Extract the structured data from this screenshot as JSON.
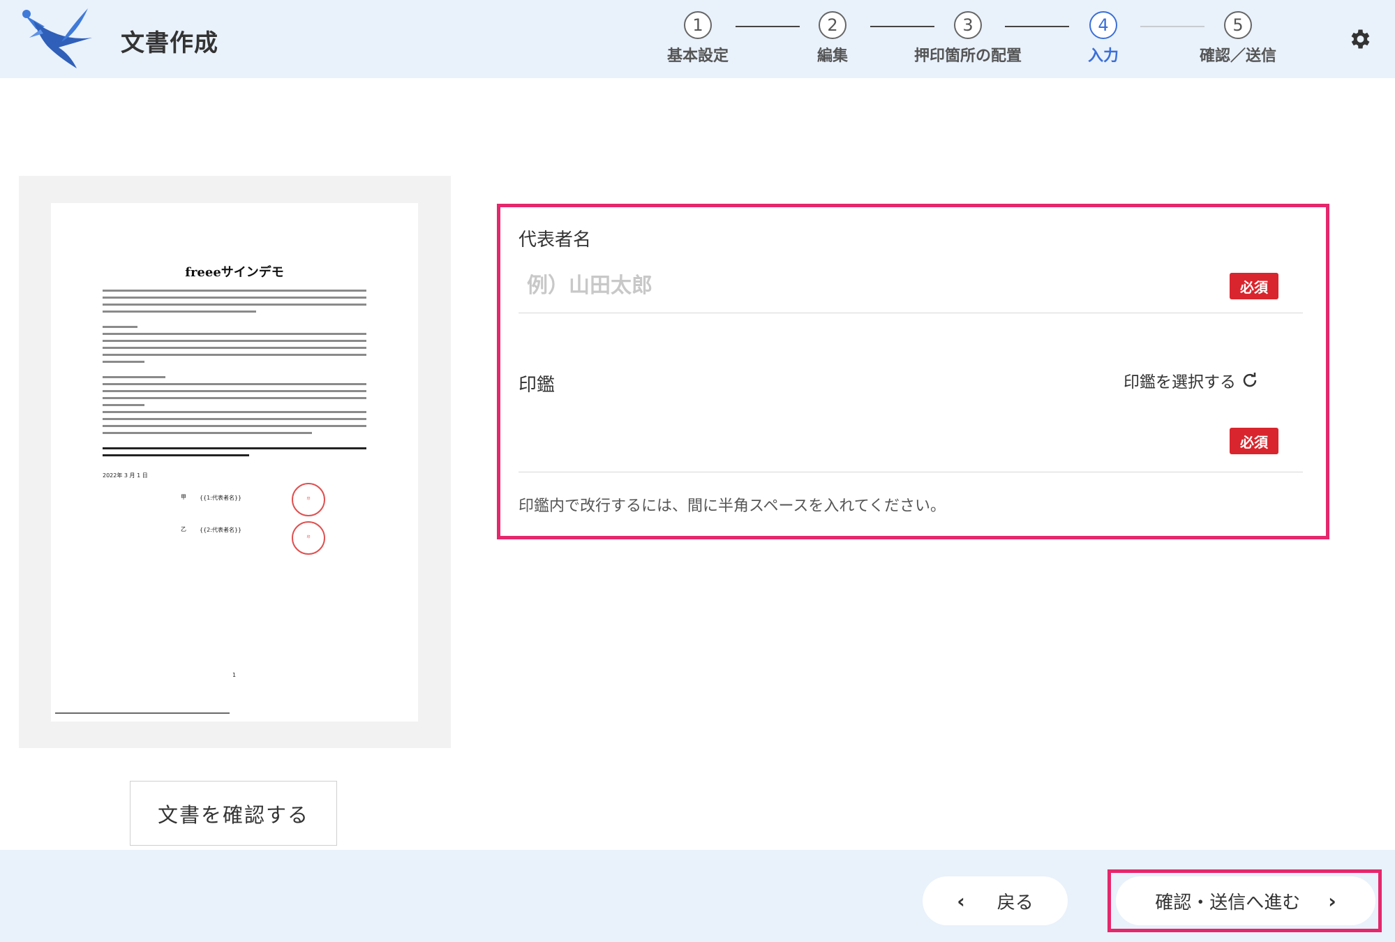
{
  "header": {
    "title": "文書作成",
    "steps": [
      {
        "number": "1",
        "label": "基本設定"
      },
      {
        "number": "2",
        "label": "編集"
      },
      {
        "number": "3",
        "label": "押印箇所の配置"
      },
      {
        "number": "4",
        "label": "入力"
      },
      {
        "number": "5",
        "label": "確認／送信"
      }
    ],
    "active_step": 4
  },
  "preview": {
    "doc_title": "freeeサインデモ",
    "date_text": "2022年 3 月 1 日",
    "party_a": "甲",
    "party_a_name": "{{1:代表者名}}",
    "party_b": "乙",
    "party_b_name": "{{2:代表者名}}",
    "page_number": "1",
    "confirm_button": "文書を確認する"
  },
  "form": {
    "rep_name_label": "代表者名",
    "rep_name_value": "",
    "rep_name_placeholder": "例）山田太郎",
    "required_label": "必須",
    "seal_label": "印鑑",
    "seal_select_label": "印鑑を選択する",
    "seal_hint": "印鑑内で改行するには、間に半角スペースを入れてください。"
  },
  "footer": {
    "back_label": "戻る",
    "next_label": "確認・送信へ進む"
  },
  "colors": {
    "accent": "#3a6fd8",
    "highlight": "#e5276b",
    "required": "#d9252d",
    "header_bg": "#e9f1fb"
  }
}
